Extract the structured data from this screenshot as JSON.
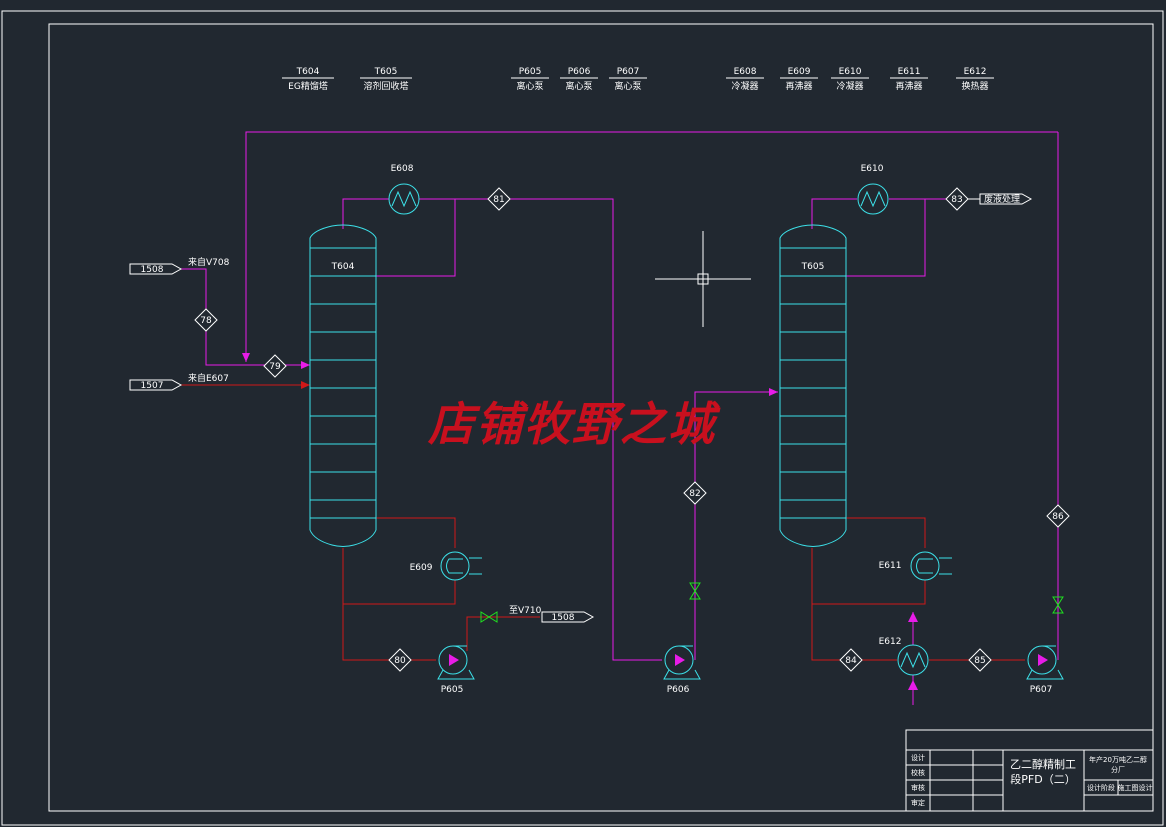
{
  "legend": [
    {
      "code": "T604",
      "desc": "EG精馏塔"
    },
    {
      "code": "T605",
      "desc": "溶剂回收塔"
    },
    {
      "code": "P605",
      "desc": "离心泵"
    },
    {
      "code": "P606",
      "desc": "离心泵"
    },
    {
      "code": "P607",
      "desc": "离心泵"
    },
    {
      "code": "E608",
      "desc": "冷凝器"
    },
    {
      "code": "E609",
      "desc": "再沸器"
    },
    {
      "code": "E610",
      "desc": "冷凝器"
    },
    {
      "code": "E611",
      "desc": "再沸器"
    },
    {
      "code": "E612",
      "desc": "换热器"
    }
  ],
  "equipment": {
    "t604": "T604",
    "t605": "T605",
    "e608": "E608",
    "e609": "E609",
    "e610": "E610",
    "e611": "E611",
    "e612": "E612",
    "p605": "P605",
    "p606": "P606",
    "p607": "P607"
  },
  "streams": {
    "s78": "78",
    "s79": "79",
    "s80": "80",
    "s81": "81",
    "s82": "82",
    "s83": "83",
    "s84": "84",
    "s85": "85",
    "s86": "86"
  },
  "connectors": {
    "in1_tag": "1508",
    "in1_text": "来自V708",
    "in2_tag": "1507",
    "in2_text": "来自E607",
    "out1_tag": "1508",
    "out1_text": "至V710",
    "out2_tag": "废液处理"
  },
  "watermark": "店铺牧野之城",
  "title_block": {
    "drawing_title_line1": "乙二醇精制工",
    "drawing_title_line2": "段PFD（二）",
    "project_line1": "年产20万吨乙二醇",
    "project_line2": "分厂",
    "row_labels": [
      "设计",
      "校核",
      "审核",
      "审定"
    ],
    "cell_a": "设计阶段",
    "cell_b": "施工图设计"
  },
  "colors": {
    "background": "#212830",
    "magenta": "#e81ce8",
    "red": "#d01818",
    "cyan": "#3ce0e8",
    "green": "#20e020",
    "frame": "#ffffff"
  }
}
